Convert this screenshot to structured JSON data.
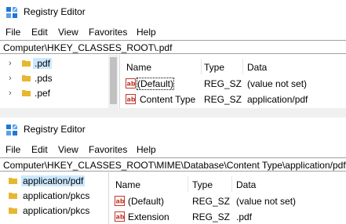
{
  "windows": [
    {
      "title": "Registry Editor",
      "menu": [
        "File",
        "Edit",
        "View",
        "Favorites",
        "Help"
      ],
      "address": "Computer\\HKEY_CLASSES_ROOT\\.pdf",
      "tree": [
        {
          "label": ".pdf",
          "selected": true
        },
        {
          "label": ".pds",
          "selected": false
        },
        {
          "label": ".pef",
          "selected": false
        }
      ],
      "columns": [
        "Name",
        "Type",
        "Data"
      ],
      "values": [
        {
          "name": "(Default)",
          "type": "REG_SZ",
          "data": "(value not set)"
        },
        {
          "name": "Content Type",
          "type": "REG_SZ",
          "data": "application/pdf"
        }
      ]
    },
    {
      "title": "Registry Editor",
      "menu": [
        "File",
        "Edit",
        "View",
        "Favorites",
        "Help"
      ],
      "address": "Computer\\HKEY_CLASSES_ROOT\\MIME\\Database\\Content Type\\application/pdf",
      "tree": [
        {
          "label": "application/pdf",
          "selected": true
        },
        {
          "label": "application/pkcs",
          "selected": false
        },
        {
          "label": "application/pkcs",
          "selected": false
        }
      ],
      "columns": [
        "Name",
        "Type",
        "Data"
      ],
      "values": [
        {
          "name": "(Default)",
          "type": "REG_SZ",
          "data": "(value not set)"
        },
        {
          "name": "Extension",
          "type": "REG_SZ",
          "data": ".pdf"
        }
      ]
    }
  ],
  "colors": {
    "selection": "#cce8ff",
    "folder": "#e8b730",
    "value_icon_red": "#c0392b",
    "app_icon_blue": "#1e78d7"
  },
  "icons": {
    "app": "registry-editor-icon",
    "folder": "folder-icon",
    "string_value": "string-value-icon",
    "chevron": "chevron-right-icon"
  }
}
